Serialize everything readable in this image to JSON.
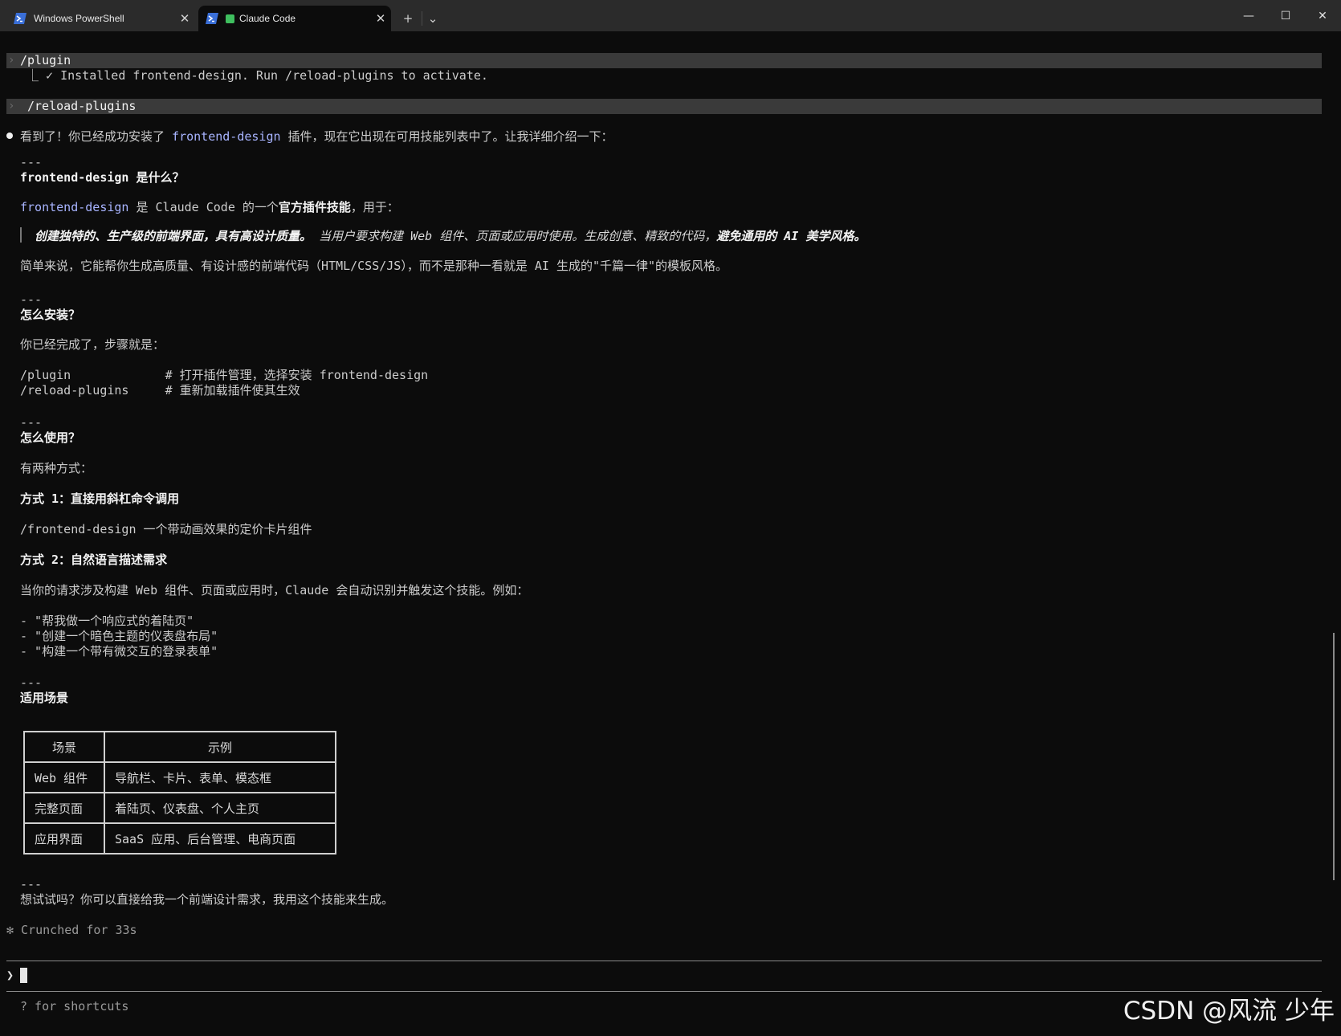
{
  "window": {
    "tabs": [
      {
        "label": "Windows PowerShell"
      },
      {
        "label": "Claude Code"
      }
    ],
    "new_tab_glyph": "+",
    "dropdown_glyph": "⌄",
    "close_glyph": "✕",
    "controls": {
      "minimize": "—",
      "maximize": "☐",
      "close": "✕"
    }
  },
  "terminal": {
    "cmd1": "/plugin",
    "cmd1_output": "⎿ ✓ Installed frontend-design. Run /reload-plugins to activate.",
    "cmd2": "/reload-plugins",
    "intro": {
      "pre": "看到了！你已经成功安装了 ",
      "highlight": "frontend-design",
      "post": " 插件，现在它出现在可用技能列表中了。让我详细介绍一下："
    },
    "sep": "---",
    "s1_title": "frontend-design 是什么？",
    "s1_line": {
      "highlight": "frontend-design",
      "mid": " 是 Claude Code 的一个",
      "bold": "官方插件技能",
      "post": "，用于："
    },
    "s1_quote": {
      "bold1": "创建独特的、生产级的前端界面，具有高设计质量。",
      "mid": " 当用户要求构建 Web 组件、页面或应用时使用。生成创意、精致的代码，",
      "bold2": "避免通用的 AI 美学风格。"
    },
    "s1_summary": "简单来说，它能帮你生成高质量、有设计感的前端代码（HTML/CSS/JS），而不是那种一看就是 AI 生成的\"千篇一律\"的模板风格。",
    "s2_title": "怎么安装？",
    "s2_intro": "你已经完成了，步骤就是：",
    "s2_code1": "/plugin             # 打开插件管理，选择安装 frontend-design",
    "s2_code2": "/reload-plugins     # 重新加载插件使其生效",
    "s3_title": "怎么使用？",
    "s3_intro": "有两种方式：",
    "s3_m1_title": "方式 1：直接用斜杠命令调用",
    "s3_m1_example": "/frontend-design 一个带动画效果的定价卡片组件",
    "s3_m2_title": "方式 2：自然语言描述需求",
    "s3_m2_desc": "当你的请求涉及构建 Web 组件、页面或应用时，Claude 会自动识别并触发这个技能。例如：",
    "s3_examples": [
      "- \"帮我做一个响应式的着陆页\"",
      "- \"创建一个暗色主题的仪表盘布局\"",
      "- \"构建一个带有微交互的登录表单\""
    ],
    "s4_title": "适用场景",
    "table": {
      "headers": [
        "场景",
        "示例"
      ],
      "rows": [
        [
          "Web 组件",
          "导航栏、卡片、表单、模态框"
        ],
        [
          "完整页面",
          "着陆页、仪表盘、个人主页"
        ],
        [
          "应用界面",
          "SaaS 应用、后台管理、电商页面"
        ]
      ]
    },
    "closing": "想试试吗？你可以直接给我一个前端设计需求，我用这个技能来生成。",
    "status": "✻ Crunched for 33s",
    "prompt_glyph": "❯",
    "hint": "? for shortcuts"
  },
  "watermark": "CSDN @风流 少年",
  "colors": {
    "background": "#0c0c0c",
    "titlebar": "#2b2b2b",
    "highlight": "#a8b4ff",
    "command_bar": "#3a3a3a"
  }
}
